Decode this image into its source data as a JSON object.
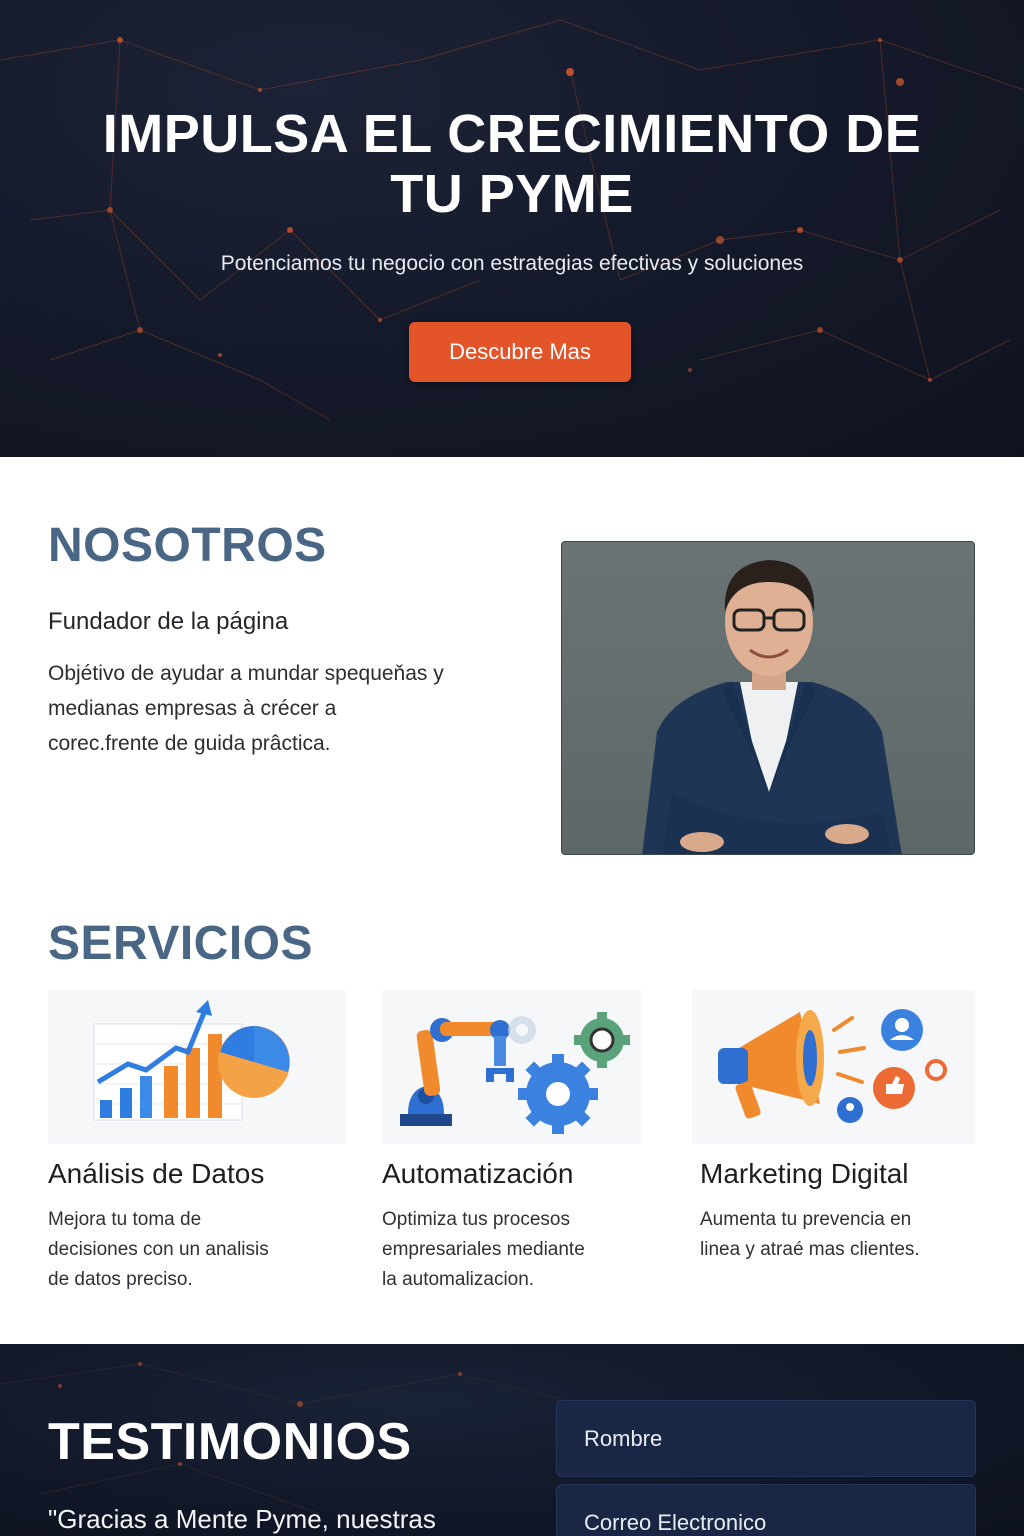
{
  "hero": {
    "title_line1": "IMPULSA EL CRECIMIENTO DE",
    "title_line2": "TU PYME",
    "subtitle": "Potenciamos tu negocio con estrategias efectivas y soluciones",
    "cta_label": "Descubre Mas"
  },
  "about": {
    "title": "NOSOTROS",
    "subtitle": "Fundador de la página",
    "text_lines": [
      "Objétivo de ayudar a mundar spequeňas y",
      "medianas empresas à crécer a",
      "corec.frente de guida prâcticа."
    ]
  },
  "services": {
    "title": "SERVICIOS",
    "items": [
      {
        "title": "Análisis de Datos",
        "desc_lines": [
          "Mejora tu toma de",
          "decisiones con un analisis",
          "de datos preciso."
        ],
        "icon": "bar-chart-icon"
      },
      {
        "title": "Automatización",
        "desc_lines": [
          "Optimiza tus procesos",
          "empresariales mediante",
          "la automalizacion."
        ],
        "icon": "robot-arm-icon"
      },
      {
        "title": "Marketing Digital",
        "desc_lines": [
          "Aumenta tu prevencia en",
          "linea y atraé mas clientes."
        ],
        "icon": "megaphone-icon"
      }
    ]
  },
  "testimonials": {
    "title": "TESTIMONIOS",
    "quote_start": "\"Gracias a Mente Pyme,  nuestras",
    "form": {
      "name_placeholder": "Rombre",
      "email_placeholder": "Correo Electronico"
    }
  },
  "colors": {
    "accent": "#e35428",
    "heading": "#4a6685",
    "dark_bg": "#151a2b"
  }
}
